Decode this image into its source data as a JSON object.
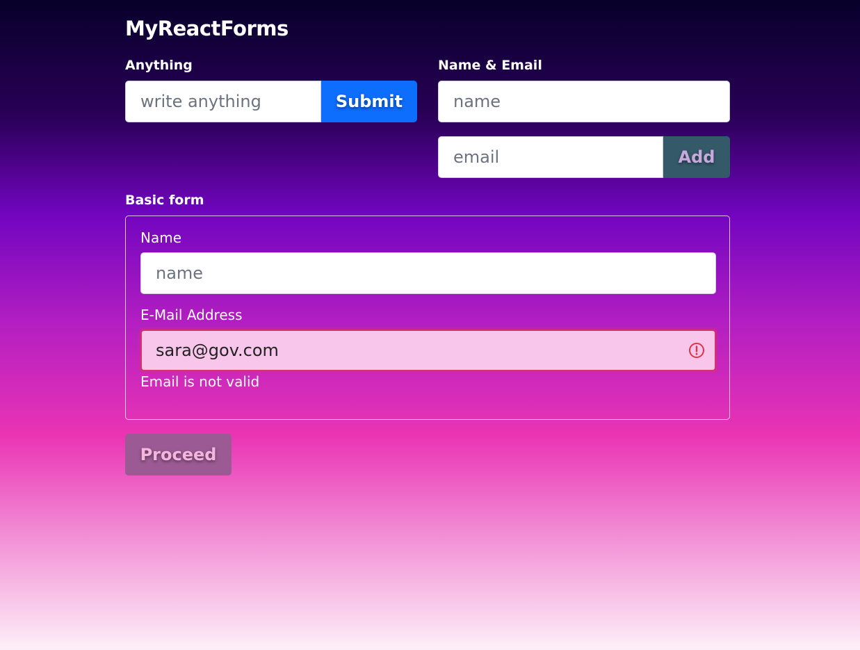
{
  "app": {
    "title": "MyReactForms"
  },
  "anything_form": {
    "label": "Anything",
    "input_value": "",
    "input_placeholder": "write anything",
    "submit_label": "Submit"
  },
  "name_email_form": {
    "label": "Name & Email",
    "name_value": "",
    "name_placeholder": "name",
    "email_value": "",
    "email_placeholder": "email",
    "add_label": "Add"
  },
  "basic_form": {
    "label": "Basic form",
    "name_label": "Name",
    "name_value": "",
    "name_placeholder": "name",
    "email_label": "E-Mail Address",
    "email_value": "sara@gov.com",
    "email_error": "Email is not valid",
    "error_icon": "exclamation-circle-icon",
    "proceed_label": "Proceed"
  },
  "colors": {
    "primary_button": "#0d6efd",
    "add_button": "#345a6a",
    "invalid_border": "#d6336c",
    "invalid_background": "#f8c6ea",
    "proceed_button": "#9b5a93"
  }
}
